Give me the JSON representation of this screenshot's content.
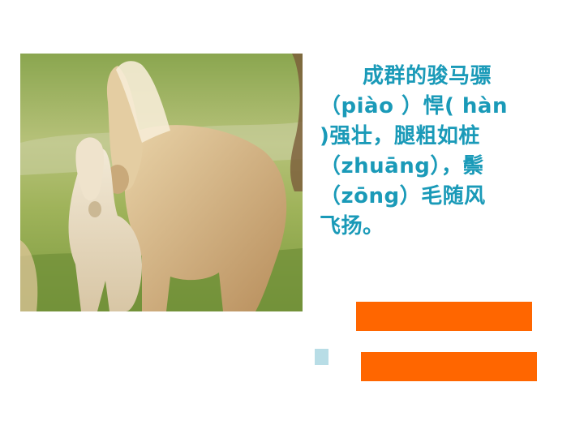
{
  "slide": {
    "image": {
      "subject": "horses-photo",
      "accent": "#d9b98a"
    },
    "text_lines": [
      "　　成群的骏马骠",
      "（piào ）悍( hàn",
      ")强壮，腿粗如桩",
      "（zhuāng），鬃",
      "（zōng）毛随风",
      "飞扬。"
    ],
    "text_color": "#1a9ab8",
    "bar_color": "#ff6600"
  }
}
